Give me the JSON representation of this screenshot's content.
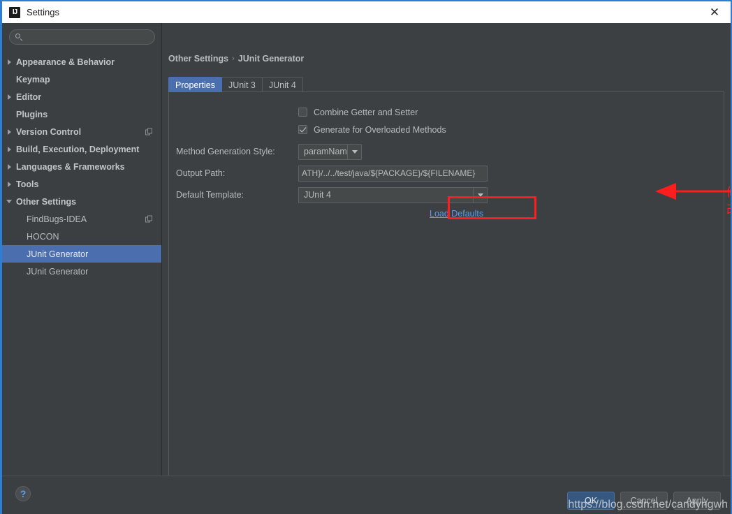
{
  "window": {
    "title": "Settings",
    "app_icon": "intellij-idea-icon",
    "close_label": "✕",
    "accent_border": "#2d7fd3"
  },
  "search": {
    "placeholder": "",
    "value": "",
    "icon": "search-icon"
  },
  "sidebar": {
    "items": [
      {
        "label": "Appearance & Behavior",
        "arrow": "collapsed",
        "indent": false,
        "bold": true,
        "selected": false,
        "badge": false
      },
      {
        "label": "Keymap",
        "arrow": "none",
        "indent": false,
        "bold": true,
        "selected": false,
        "badge": false
      },
      {
        "label": "Editor",
        "arrow": "collapsed",
        "indent": false,
        "bold": true,
        "selected": false,
        "badge": false
      },
      {
        "label": "Plugins",
        "arrow": "none",
        "indent": false,
        "bold": true,
        "selected": false,
        "badge": false
      },
      {
        "label": "Version Control",
        "arrow": "collapsed",
        "indent": false,
        "bold": true,
        "selected": false,
        "badge": true
      },
      {
        "label": "Build, Execution, Deployment",
        "arrow": "collapsed",
        "indent": false,
        "bold": true,
        "selected": false,
        "badge": false
      },
      {
        "label": "Languages & Frameworks",
        "arrow": "collapsed",
        "indent": false,
        "bold": true,
        "selected": false,
        "badge": false
      },
      {
        "label": "Tools",
        "arrow": "collapsed",
        "indent": false,
        "bold": true,
        "selected": false,
        "badge": false
      },
      {
        "label": "Other Settings",
        "arrow": "expanded",
        "indent": false,
        "bold": true,
        "selected": false,
        "badge": false
      },
      {
        "label": "FindBugs-IDEA",
        "arrow": "none",
        "indent": true,
        "bold": false,
        "selected": false,
        "badge": true
      },
      {
        "label": "HOCON",
        "arrow": "none",
        "indent": true,
        "bold": false,
        "selected": false,
        "badge": false
      },
      {
        "label": "JUnit Generator",
        "arrow": "none",
        "indent": true,
        "bold": false,
        "selected": true,
        "badge": false
      },
      {
        "label": "JUnit Generator",
        "arrow": "none",
        "indent": true,
        "bold": false,
        "selected": false,
        "badge": false
      }
    ],
    "selection_color": "#4b6eaf"
  },
  "breadcrumb": {
    "root": "Other Settings",
    "separator": "›",
    "current": "JUnit Generator"
  },
  "tabs": [
    {
      "label": "Properties",
      "active": true
    },
    {
      "label": "JUnit 3",
      "active": false
    },
    {
      "label": "JUnit 4",
      "active": false
    }
  ],
  "form": {
    "combine_getter_setter": {
      "label": "Combine Getter and Setter",
      "checked": false
    },
    "generate_overloaded": {
      "label": "Generate for Overloaded Methods",
      "checked": true
    },
    "method_generation_style": {
      "label": "Method Generation Style:",
      "value": "paramName",
      "icon": "chevron-down-icon"
    },
    "output_path": {
      "label": "Output Path:",
      "value": "ATH}/../../test/java/${PACKAGE}/${FILENAME}"
    },
    "default_template": {
      "label": "Default Template:",
      "value": "JUnit 4",
      "icon": "chevron-down-icon"
    },
    "load_defaults_link": "Load Defaults"
  },
  "annotation": {
    "text": "修改",
    "color": "#ff1d1d",
    "highlight_target": "default-template-combo"
  },
  "footer": {
    "help_label": "?",
    "buttons": [
      {
        "label": "OK",
        "primary": true
      },
      {
        "label": "Cancel",
        "primary": false
      },
      {
        "label": "Apply",
        "primary": false
      }
    ]
  },
  "watermark": {
    "text": "https://blog.csdn.net/candyngwh"
  }
}
